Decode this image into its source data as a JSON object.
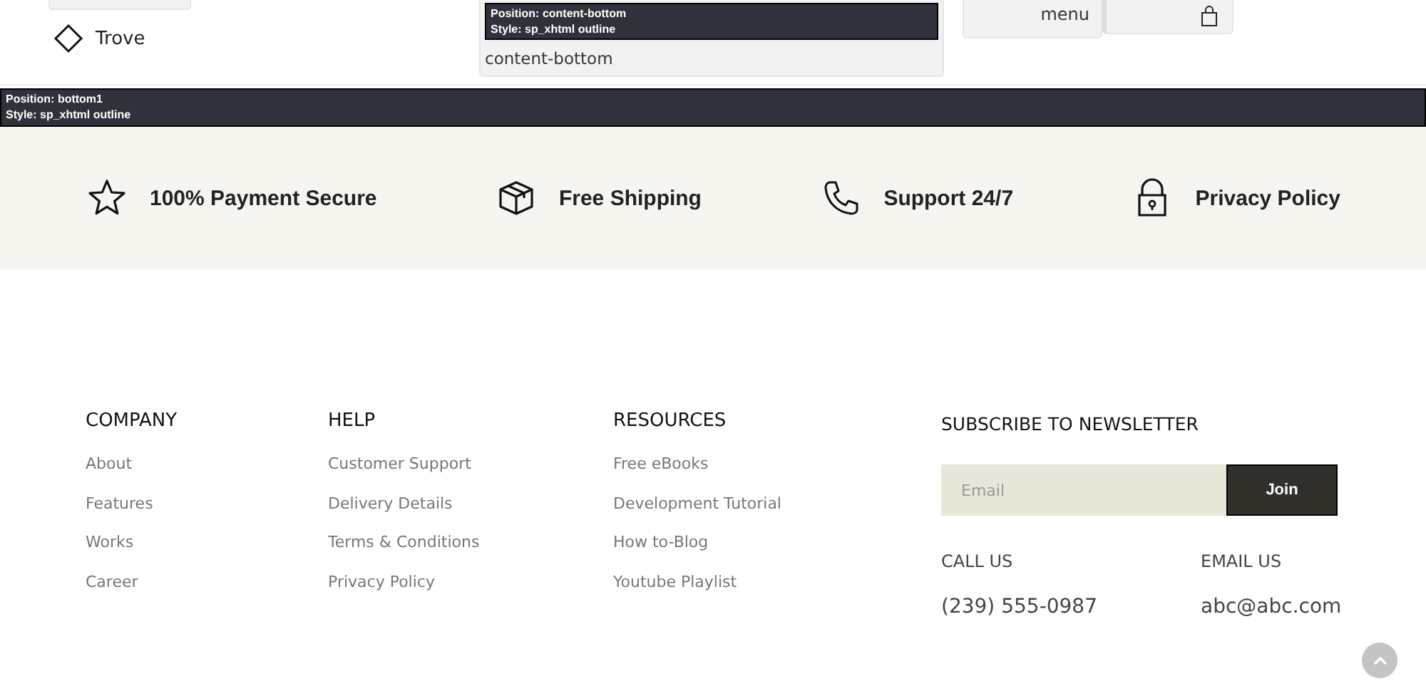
{
  "header": {
    "logo": "Trove",
    "module": {
      "tooltip": [
        "Position: content-bottom",
        "Style: sp_xhtml outline"
      ],
      "label": "content-bottom"
    },
    "menu_button": "menu"
  },
  "position_bar": [
    "Position: bottom1",
    "Style: sp_xhtml outline"
  ],
  "features": [
    {
      "kind": "star",
      "label": "100% Payment Secure"
    },
    {
      "kind": "box",
      "label": "Free Shipping"
    },
    {
      "kind": "phone",
      "label": "Support 24/7"
    },
    {
      "kind": "lock",
      "label": "Privacy Policy"
    }
  ],
  "footer": {
    "columns": [
      {
        "title": "COMPANY",
        "links": [
          "About",
          "Features",
          "Works",
          "Career"
        ]
      },
      {
        "title": "HELP",
        "links": [
          "Customer Support",
          "Delivery Details",
          "Terms & Conditions",
          "Privacy Policy"
        ]
      },
      {
        "title": "RESOURCES",
        "links": [
          "Free eBooks",
          "Development Tutorial",
          "How to-Blog",
          "Youtube Playlist"
        ]
      }
    ],
    "newsletter": {
      "title": "SUBSCRIBE TO NEWSLETTER",
      "placeholder": "Email",
      "button": "Join"
    },
    "contacts": [
      {
        "label": "CALL US",
        "value": "(239) 555-0987"
      },
      {
        "label": "EMAIL US",
        "value": "abc@abc.com"
      }
    ]
  }
}
